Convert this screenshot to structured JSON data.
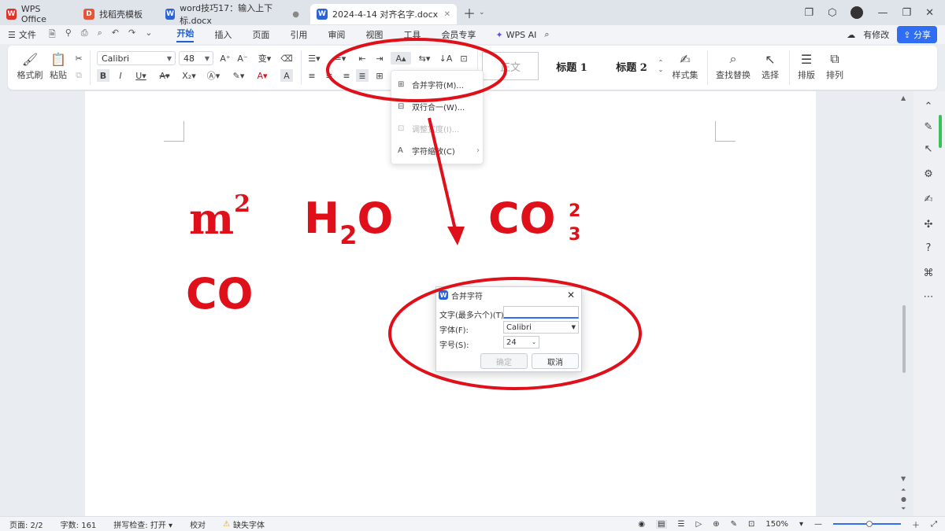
{
  "tabs": [
    {
      "label": "WPS Office",
      "icon": "wps-logo-icon"
    },
    {
      "label": "找稻壳模板",
      "icon": "docer-icon"
    },
    {
      "label": "word技巧17：输入上下标.docx",
      "icon": "word-doc-icon"
    },
    {
      "label": "2024-4-14 对齐名字.docx",
      "icon": "word-doc-icon",
      "active": true
    }
  ],
  "menubar": {
    "file": "文件",
    "items": [
      "开始",
      "插入",
      "页面",
      "引用",
      "审阅",
      "视图",
      "工具",
      "会员专享"
    ],
    "active": "开始",
    "wps_ai": "WPS AI",
    "modified": "有修改",
    "share": "分享"
  },
  "ribbon": {
    "format_painter": "格式刷",
    "paste": "粘贴",
    "font_name": "Calibri",
    "font_size": "48",
    "styles": {
      "normal": "正文",
      "h1": "标题 1",
      "h2": "标题 2"
    },
    "style_set": "样式集",
    "find_replace": "查找替换",
    "select": "选择",
    "layout": "排版",
    "arrange": "排列"
  },
  "dropdown": {
    "items": [
      {
        "label": "合并字符(M)...",
        "disabled": false
      },
      {
        "label": "双行合一(W)...",
        "disabled": false
      },
      {
        "label": "调整宽度(I)...",
        "disabled": true
      },
      {
        "label": "字符缩放(C)",
        "disabled": false,
        "submenu": true
      }
    ]
  },
  "document": {
    "m2": {
      "base": "m",
      "sup": "2"
    },
    "h2o": {
      "h": "H",
      "sub": "2",
      "o": "O"
    },
    "co_stack": {
      "base": "CO",
      "top": "2",
      "bottom": "3"
    },
    "co": "CO"
  },
  "dialog": {
    "title": "合并字符",
    "text_label": "文字(最多六个)(T):",
    "text_value": "",
    "font_label": "字体(F):",
    "font_value": "Calibri",
    "size_label": "字号(S):",
    "size_value": "24",
    "ok": "确定",
    "cancel": "取消"
  },
  "statusbar": {
    "page": "页面: 2/2",
    "words": "字数: 161",
    "spell": "拼写检查: 打开",
    "proof": "校对",
    "missing_font": "缺失字体",
    "zoom": "150%"
  },
  "colors": {
    "accent": "#1f5ed8",
    "annotation": "#e0101a",
    "share": "#2f6ef2"
  }
}
